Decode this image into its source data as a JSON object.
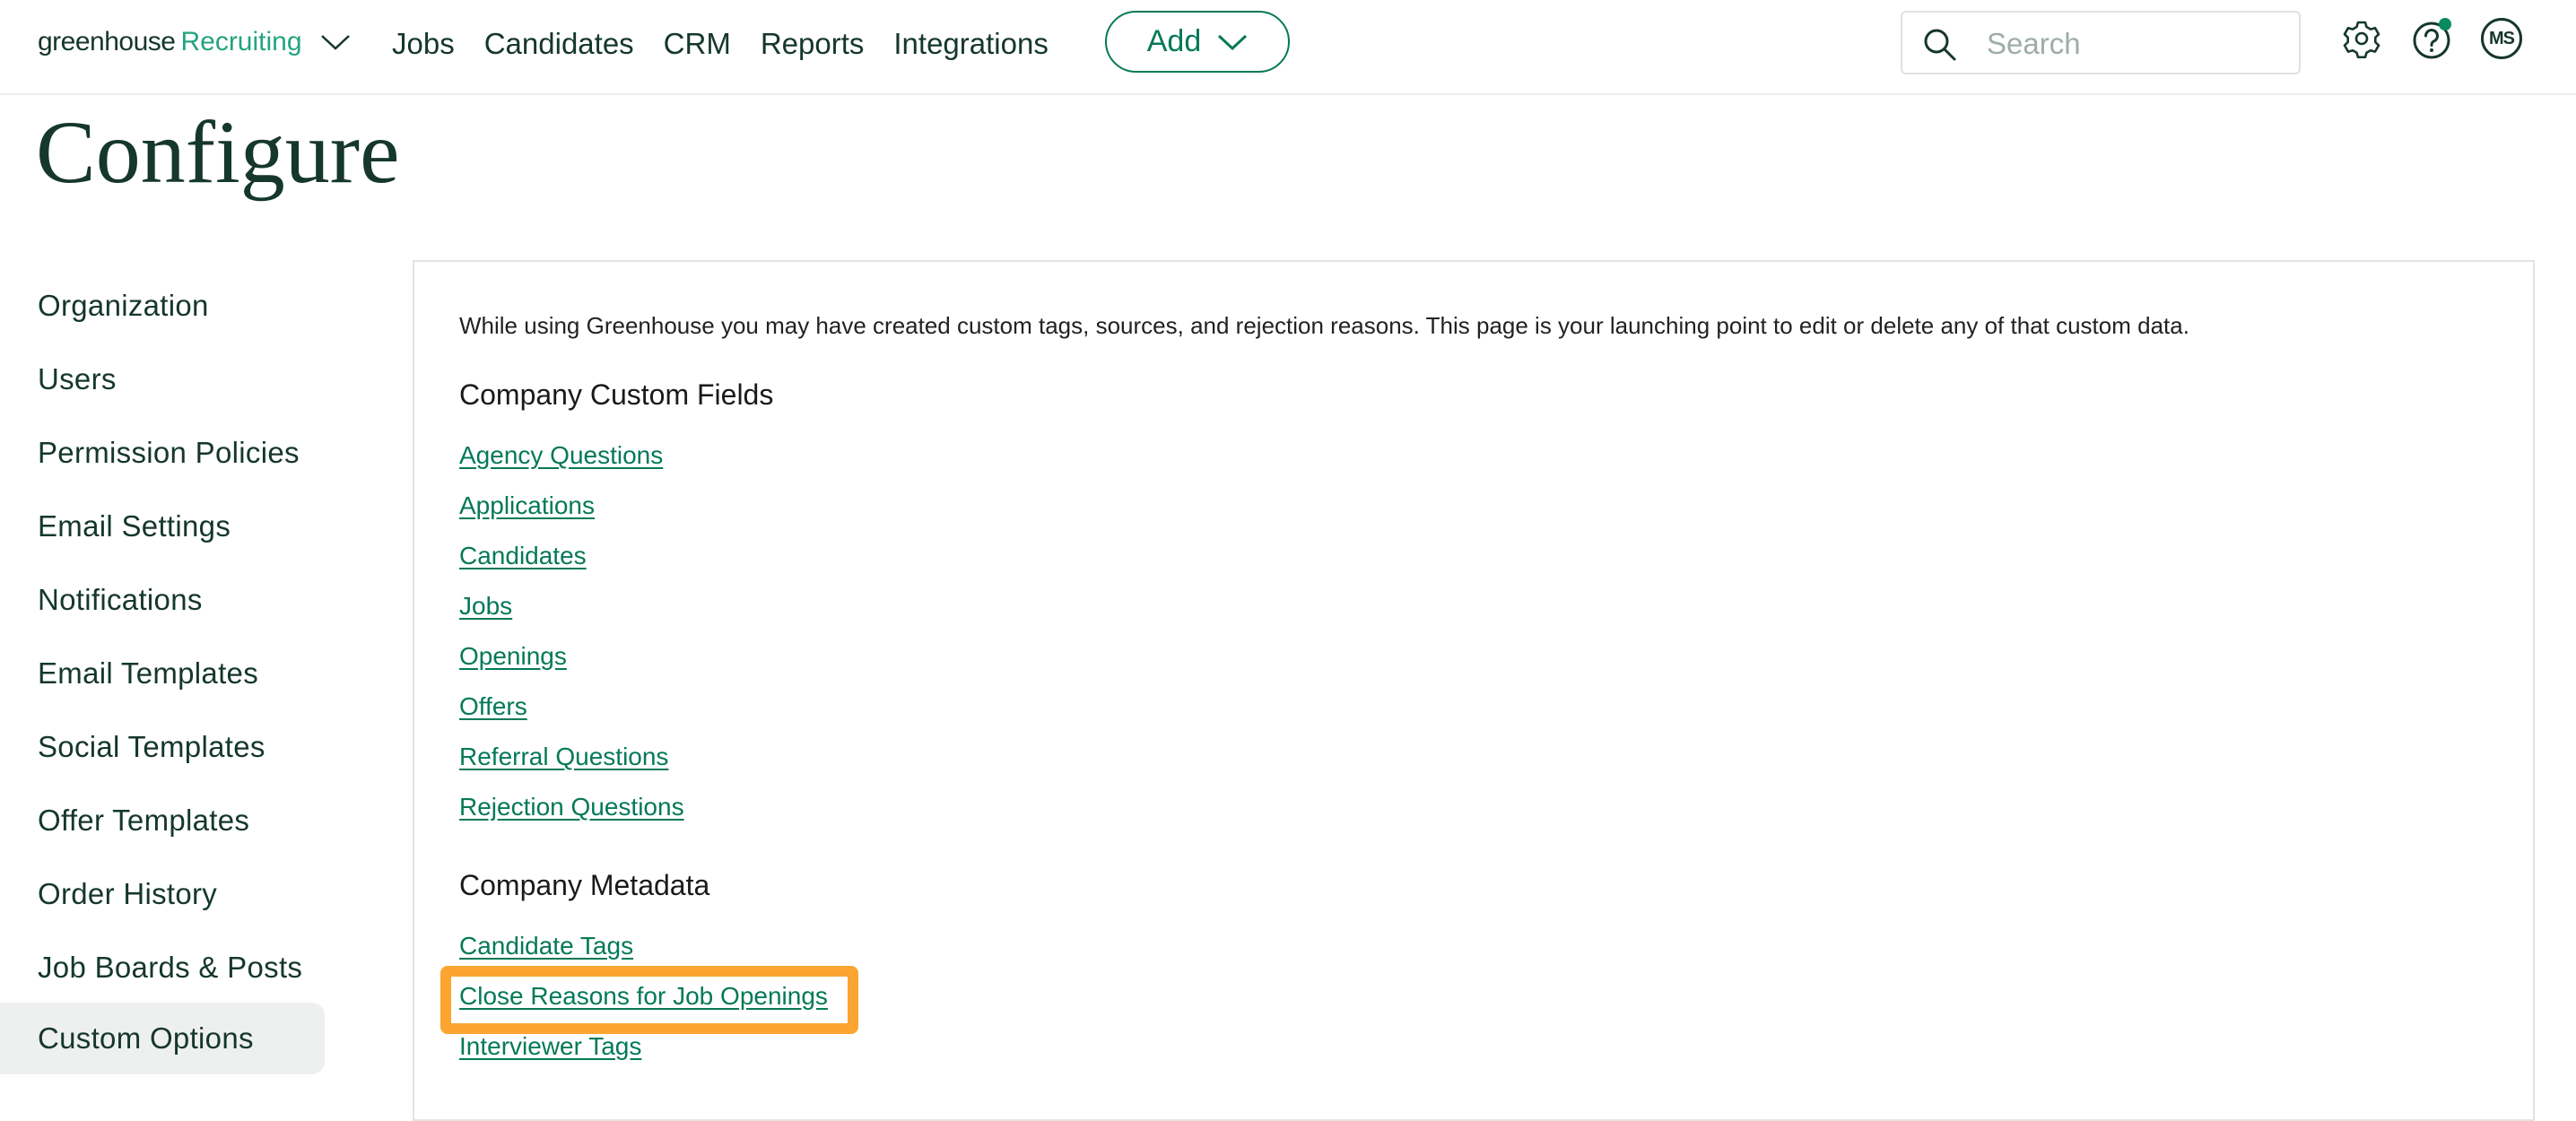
{
  "header": {
    "logo_brand": "greenhouse",
    "logo_product": "Recruiting",
    "nav": [
      "Jobs",
      "Candidates",
      "CRM",
      "Reports",
      "Integrations"
    ],
    "add_label": "Add",
    "search_placeholder": "Search",
    "search_value": "",
    "avatar_initials": "MS",
    "icons": {
      "logo_menu": "chevron-down-icon",
      "search": "search-icon",
      "settings": "gear-icon",
      "help": "help-icon",
      "help_badge": "notification-dot"
    }
  },
  "page": {
    "title": "Configure"
  },
  "sidebar": {
    "items": [
      {
        "label": "Organization",
        "active": false
      },
      {
        "label": "Users",
        "active": false
      },
      {
        "label": "Permission Policies",
        "active": false
      },
      {
        "label": "Email Settings",
        "active": false
      },
      {
        "label": "Notifications",
        "active": false
      },
      {
        "label": "Email Templates",
        "active": false
      },
      {
        "label": "Social Templates",
        "active": false
      },
      {
        "label": "Offer Templates",
        "active": false
      },
      {
        "label": "Order History",
        "active": false
      },
      {
        "label": "Job Boards & Posts",
        "active": false
      },
      {
        "label": "Custom Options",
        "active": true
      }
    ]
  },
  "content": {
    "intro": "While using Greenhouse you may have created custom tags, sources, and rejection reasons. This page is your launching point to edit or delete any of that custom data.",
    "sections": [
      {
        "title": "Company Custom Fields",
        "links": [
          "Agency Questions",
          "Applications",
          "Candidates",
          "Jobs",
          "Openings",
          "Offers",
          "Referral Questions",
          "Rejection Questions"
        ]
      },
      {
        "title": "Company Metadata",
        "links": [
          "Candidate Tags",
          "Close Reasons for Job Openings",
          "Interviewer Tags"
        ]
      }
    ],
    "highlighted_link": "Close Reasons for Job Openings"
  },
  "colors": {
    "brand_dark": "#15372c",
    "brand_green": "#047957",
    "logo_green": "#24a47f",
    "highlight": "#fba430",
    "active_bg": "#eef0ef"
  }
}
